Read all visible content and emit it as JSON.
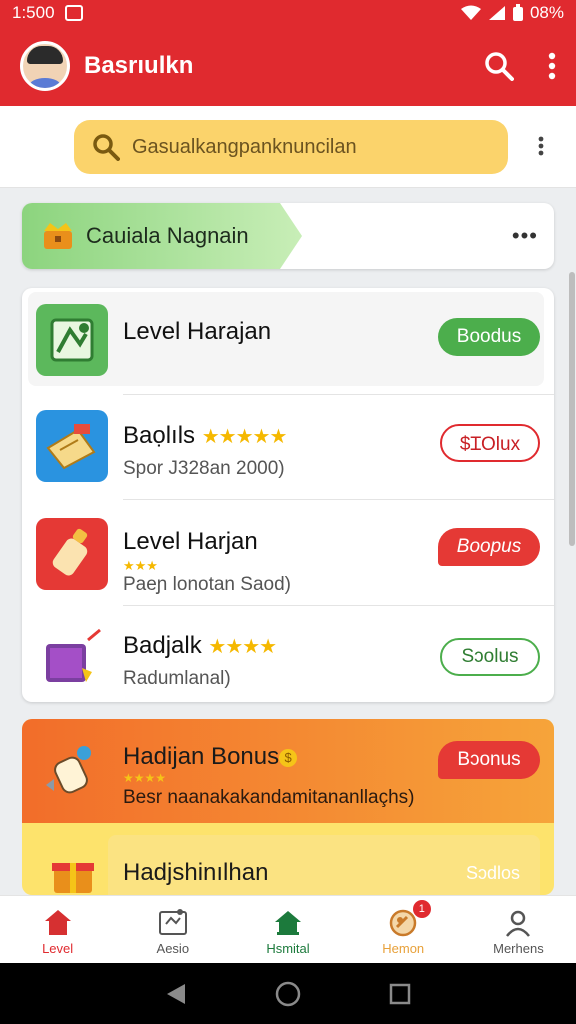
{
  "status_bar": {
    "time": "1:500",
    "battery": "08%"
  },
  "app_bar": {
    "title": "Basrıulkn",
    "search_icon": "search-icon",
    "menu_icon": "more-vertical-icon"
  },
  "search": {
    "placeholder": "Gasualkangpanknuncilan"
  },
  "section": {
    "title": "Cauiala Nagnain",
    "more": "•••"
  },
  "list": [
    {
      "title": "Level Harajan",
      "subtitle": "",
      "stars": "",
      "button": "Boodus",
      "button_style": "green-filled",
      "icon": "map-icon"
    },
    {
      "title": "Baọlıls",
      "subtitle": "Spor J328an 2000)",
      "stars": "★★★★★",
      "button": "$ꞮOlux",
      "button_style": "red-outline",
      "icon": "ticket-icon"
    },
    {
      "title": "Level Harjan",
      "subtitle": "Paeɲ lonotan Saod)",
      "stars": "★★★",
      "button": "Boopus",
      "button_style": "red-bubble",
      "icon": "bottle-icon"
    },
    {
      "title": "Badjalk",
      "subtitle": "Radumlanal)",
      "stars": "★★★★",
      "button": "Sɔolus",
      "button_style": "green-outline",
      "icon": "gift-box-icon"
    }
  ],
  "promo": {
    "title": "Hadijan Bonus",
    "coin": "$",
    "stars": "★★★★",
    "subtitle": "Besr naanakakandamitananllaçhs)",
    "button": "Bɔonus",
    "second_title": "Hadjshinılhan",
    "second_button": "Sɔdlos"
  },
  "bottom_nav": [
    {
      "label": "Level",
      "icon": "home-icon",
      "color": "#e02a2f"
    },
    {
      "label": "Aesio",
      "icon": "certificate-icon",
      "color": "#555555"
    },
    {
      "label": "Hsmital",
      "icon": "house-icon",
      "color": "#1c7a3c"
    },
    {
      "label": "Hemon",
      "icon": "medal-icon",
      "color": "#e8a13a",
      "badge": "1"
    },
    {
      "label": "Merhens",
      "icon": "profile-icon",
      "color": "#555555"
    }
  ]
}
